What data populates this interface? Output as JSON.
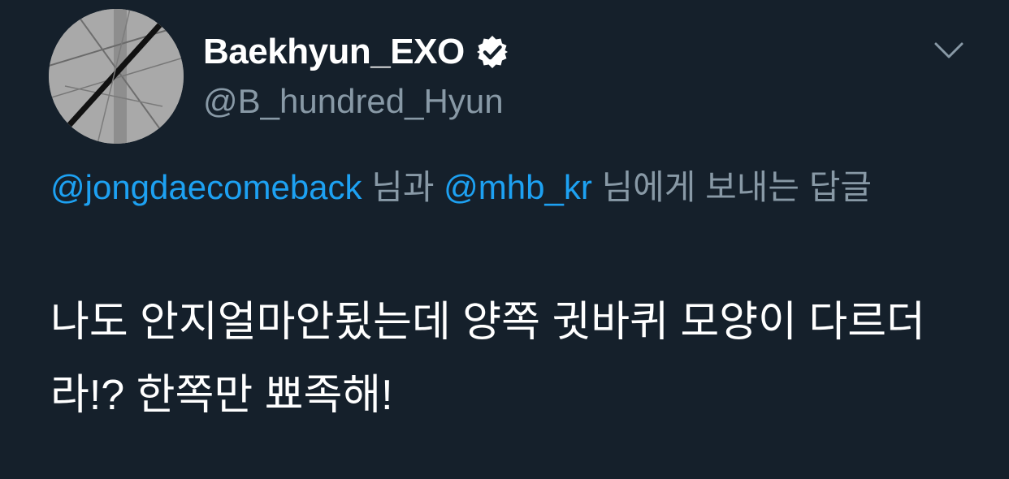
{
  "tweet": {
    "display_name": "Baekhyun_EXO",
    "handle": "@B_hundred_Hyun",
    "verified": true,
    "avatar_icon": "avatar-image",
    "menu_icon": "chevron-down-icon",
    "reply_context": {
      "mention_1": "@jongdaecomeback",
      "connector": " 님과 ",
      "mention_2": "@mhb_kr",
      "suffix": " 님에게 보내는 답글"
    },
    "text": "나도 안지얼마안됬는데 양쪽 귓바퀴 모양이 다르더라!? 한쪽만 뾰족해!"
  },
  "colors": {
    "background": "#15202b",
    "primary_text": "#ffffff",
    "secondary_text": "#8899a6",
    "link": "#1da1f2"
  }
}
